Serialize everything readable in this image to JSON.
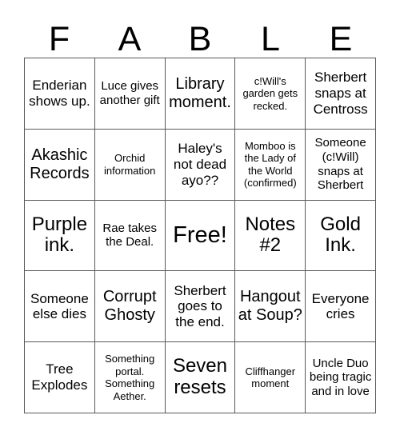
{
  "header": {
    "letters": [
      "F",
      "A",
      "B",
      "L",
      "E"
    ]
  },
  "grid": {
    "rows": 5,
    "columns": 5,
    "border_color": "#595959",
    "background_color": "#ffffff",
    "text_color": "#000000",
    "cells": [
      {
        "text": "Enderian shows up.",
        "size": "fs-md",
        "free": false
      },
      {
        "text": "Luce gives another gift",
        "size": "fs-sm",
        "free": false
      },
      {
        "text": "Library moment.",
        "size": "fs-lg",
        "free": false
      },
      {
        "text": "c!Will's garden gets recked.",
        "size": "fs-xs",
        "free": false
      },
      {
        "text": "Sherbert snaps at Centross",
        "size": "fs-md",
        "free": false
      },
      {
        "text": "Akashic Records",
        "size": "fs-lg",
        "free": false
      },
      {
        "text": "Orchid information",
        "size": "fs-xs",
        "free": false
      },
      {
        "text": "Haley's not dead ayo??",
        "size": "fs-md",
        "free": false
      },
      {
        "text": "Momboo is the Lady of the World (confirmed)",
        "size": "fs-xs",
        "free": false
      },
      {
        "text": "Someone (c!Will) snaps at Sherbert",
        "size": "fs-sm",
        "free": false
      },
      {
        "text": "Purple ink.",
        "size": "fs-xl",
        "free": false
      },
      {
        "text": "Rae takes the Deal.",
        "size": "fs-sm",
        "free": false
      },
      {
        "text": "Free!",
        "size": "fs-xxl",
        "free": true
      },
      {
        "text": "Notes #2",
        "size": "fs-xl",
        "free": false
      },
      {
        "text": "Gold Ink.",
        "size": "fs-xl",
        "free": false
      },
      {
        "text": "Someone else dies",
        "size": "fs-md",
        "free": false
      },
      {
        "text": "Corrupt Ghosty",
        "size": "fs-lg",
        "free": false
      },
      {
        "text": "Sherbert goes to the end.",
        "size": "fs-md",
        "free": false
      },
      {
        "text": "Hangout at Soup?",
        "size": "fs-lg",
        "free": false
      },
      {
        "text": "Everyone cries",
        "size": "fs-md",
        "free": false
      },
      {
        "text": "Tree Explodes",
        "size": "fs-md",
        "free": false
      },
      {
        "text": "Something portal. Something Aether.",
        "size": "fs-xs",
        "free": false
      },
      {
        "text": "Seven resets",
        "size": "fs-xl",
        "free": false
      },
      {
        "text": "Cliffhanger moment",
        "size": "fs-xs",
        "free": false
      },
      {
        "text": "Uncle Duo being tragic and in love",
        "size": "fs-sm",
        "free": false
      }
    ]
  }
}
